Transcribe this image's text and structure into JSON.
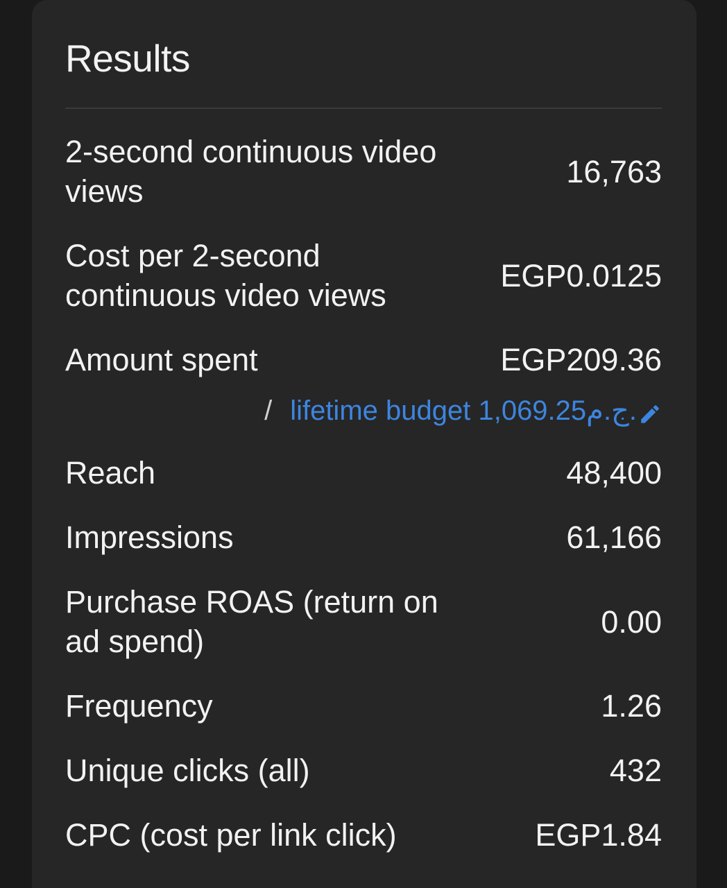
{
  "panel": {
    "title": "Results"
  },
  "metrics": [
    {
      "label": "2-second continuous video views",
      "value": "16,763"
    },
    {
      "label": "Cost per 2-second continuous video views",
      "value": "EGP0.0125"
    },
    {
      "label": "Amount spent",
      "value": "EGP209.36"
    },
    {
      "label": "Reach",
      "value": "48,400"
    },
    {
      "label": "Impressions",
      "value": "61,166"
    },
    {
      "label": "Purchase ROAS (return on ad spend)",
      "value": "0.00"
    },
    {
      "label": "Frequency",
      "value": "1.26"
    },
    {
      "label": "Unique clicks (all)",
      "value": "432"
    },
    {
      "label": "CPC (cost per link click)",
      "value": "EGP1.84"
    }
  ],
  "budget": {
    "separator": "/",
    "link_text": "lifetime budget 1,069.25ج.م.",
    "icon": "pencil-icon"
  },
  "colors": {
    "background": "#262626",
    "text": "#f2f2f2",
    "link": "#3d85e0",
    "divider": "#3b3b3b"
  }
}
